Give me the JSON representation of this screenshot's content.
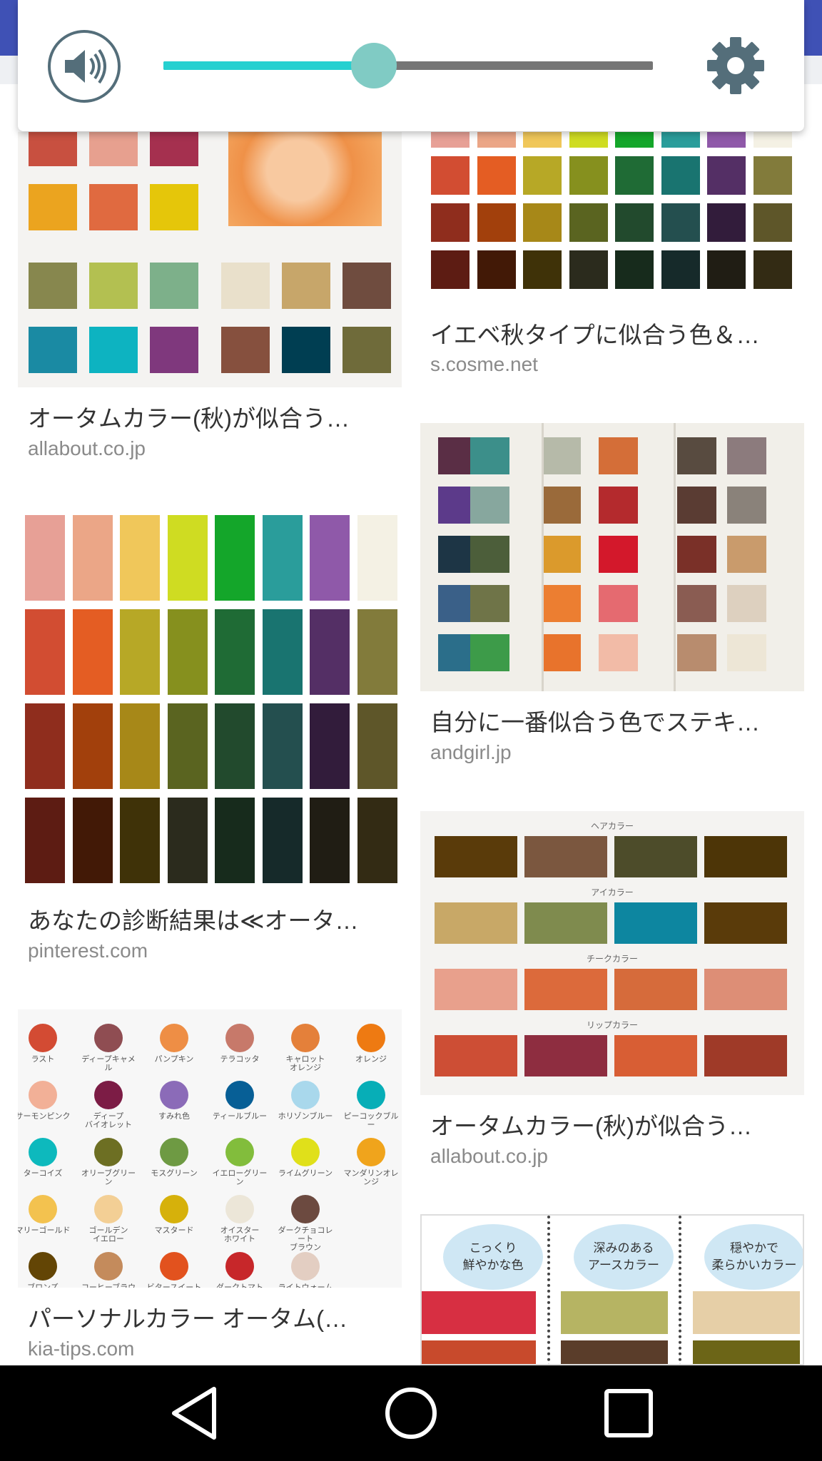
{
  "volume": {
    "level_fraction": 0.43,
    "speaker_icon": "volume-icon",
    "settings_icon": "gear-icon",
    "accent": "#26d0d0",
    "knob_color": "#80cbc4",
    "icon_color": "#546e7a"
  },
  "results_left": [
    {
      "title": "オータムカラー(秋)が似合う…",
      "source": "allabout.co.jp"
    },
    {
      "title": "あなたの診断結果は≪オータ…",
      "source": "pinterest.com"
    },
    {
      "title": "パーソナルカラー オータム(…",
      "source": "kia-tips.com"
    }
  ],
  "results_right": [
    {
      "title": "イエベ秋タイプに似合う色＆…",
      "source": "s.cosme.net"
    },
    {
      "title": "自分に一番似合う色でステキ…",
      "source": "andgirl.jp"
    },
    {
      "title": "オータムカラー(秋)が似合う…",
      "source": "allabout.co.jp"
    }
  ],
  "kia_labels": [
    [
      "ラスト",
      "ディープキャメル",
      "パンプキン",
      "テラコッタ",
      "キャロット\nオレンジ",
      "オレンジ"
    ],
    [
      "サーモンピンク",
      "ディープ\nバイオレット",
      "すみれ色",
      "ティールブルー",
      "ホリゾンブルー",
      "ピーコックブルー"
    ],
    [
      "ターコイズ",
      "オリーブグリーン",
      "モスグリーン",
      "イエローグリーン",
      "ライムグリーン",
      "マンダリンオレンジ"
    ],
    [
      "マリーゴールド",
      "ゴールデン\nイエロー",
      "マスタード",
      "オイスター\nホワイト",
      "ダークチョコレート\nブラウン",
      ""
    ],
    [
      "ブロンズ",
      "コーヒーブラウン",
      "ビタースイート\nレッド",
      "ダークトマト\nレッド",
      "ライトウォーム\nベージュ",
      ""
    ]
  ],
  "allabout_sublabels": [
    "ヘアカラー",
    "アイカラー",
    "チークカラー",
    "リップカラー"
  ],
  "bubbles": [
    "こっくり\n鮮やかな色",
    "深みのある\nアースカラー",
    "穏やかで\n柔らかいカラー"
  ],
  "nav": {
    "back_icon": "back-triangle-icon",
    "home_icon": "home-circle-icon",
    "recents_icon": "recents-square-icon"
  }
}
